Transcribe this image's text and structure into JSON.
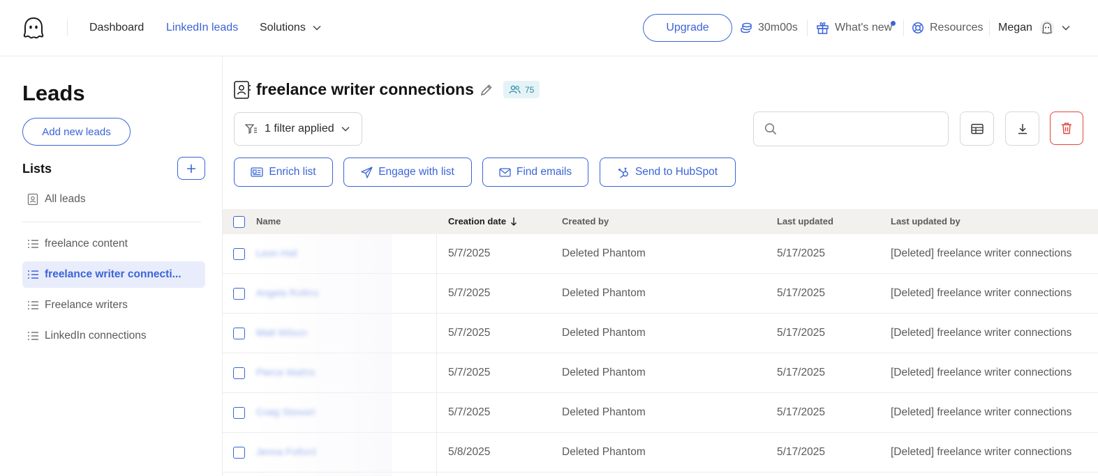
{
  "nav": {
    "links": {
      "dashboard": "Dashboard",
      "linkedin_leads": "LinkedIn leads",
      "solutions": "Solutions"
    },
    "upgrade": "Upgrade",
    "time_credits": "30m00s",
    "whats_new": "What's new",
    "resources": "Resources",
    "user_name": "Megan"
  },
  "sidebar": {
    "title": "Leads",
    "add_new_leads": "Add new leads",
    "lists_title": "Lists",
    "all_leads": "All leads",
    "lists": [
      {
        "label": "freelance content"
      },
      {
        "label": "freelance writer connecti..."
      },
      {
        "label": "Freelance writers"
      },
      {
        "label": "LinkedIn connections"
      }
    ],
    "active_index": 1
  },
  "main": {
    "list_title": "freelance writer connections",
    "lead_count": "75",
    "filter_label": "1 filter applied",
    "search_placeholder": "",
    "actions": {
      "enrich": "Enrich list",
      "engage": "Engage with list",
      "find_emails": "Find emails",
      "hubspot": "Send to HubSpot"
    }
  },
  "table": {
    "columns": {
      "name": "Name",
      "creation_date": "Creation date",
      "created_by": "Created by",
      "last_updated": "Last updated",
      "last_updated_by": "Last updated by"
    },
    "rows": [
      {
        "name": "Leon Hall",
        "creation_date": "5/7/2025",
        "created_by": "Deleted Phantom",
        "last_updated": "5/17/2025",
        "last_updated_by": "[Deleted] freelance writer connections"
      },
      {
        "name": "Angela Rollins",
        "creation_date": "5/7/2025",
        "created_by": "Deleted Phantom",
        "last_updated": "5/17/2025",
        "last_updated_by": "[Deleted] freelance writer connections"
      },
      {
        "name": "Matt Wilson",
        "creation_date": "5/7/2025",
        "created_by": "Deleted Phantom",
        "last_updated": "5/17/2025",
        "last_updated_by": "[Deleted] freelance writer connections"
      },
      {
        "name": "Pierce Mathis",
        "creation_date": "5/7/2025",
        "created_by": "Deleted Phantom",
        "last_updated": "5/17/2025",
        "last_updated_by": "[Deleted] freelance writer connections"
      },
      {
        "name": "Craig Stewart",
        "creation_date": "5/7/2025",
        "created_by": "Deleted Phantom",
        "last_updated": "5/17/2025",
        "last_updated_by": "[Deleted] freelance writer connections"
      },
      {
        "name": "Jenna Folford",
        "creation_date": "5/8/2025",
        "created_by": "Deleted Phantom",
        "last_updated": "5/17/2025",
        "last_updated_by": "[Deleted] freelance writer connections"
      }
    ]
  },
  "colors": {
    "accent": "#3a64d8",
    "danger": "#e0463c",
    "header_bg": "#f3f1ee",
    "active_bg": "#e9edfb"
  },
  "icons": [
    "ghost-logo-icon",
    "chevron-down-icon",
    "coins-icon",
    "gift-icon",
    "lifebuoy-icon",
    "avatar-ghost-icon",
    "plus-icon",
    "contact-list-icon",
    "list-icon",
    "pencil-icon",
    "people-icon",
    "filter-icon",
    "search-icon",
    "table-columns-icon",
    "download-icon",
    "trash-icon",
    "id-card-icon",
    "send-icon",
    "mail-icon",
    "hubspot-icon",
    "arrow-down-icon"
  ]
}
